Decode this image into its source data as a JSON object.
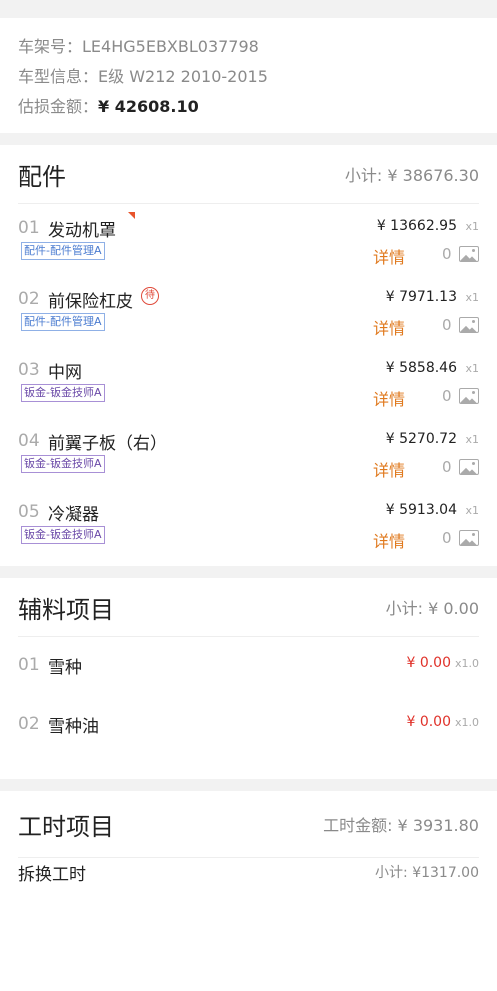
{
  "vehicle": {
    "vin_label": "车架号：",
    "vin": "LE4HG5EBXBL037798",
    "model_label": "车型信息：",
    "model": "E级 W212 2010-2015",
    "loss_label": "估损金额：",
    "loss": "¥ 42608.10"
  },
  "parts": {
    "title": "配件",
    "subtotal": "小计: ¥ 38676.30",
    "detail_label": "详情",
    "items": [
      {
        "no": "01",
        "name": "发动机罩",
        "tag": "配件-配件管理A",
        "price": "¥ 13662.95",
        "qty": "x1",
        "count": "0"
      },
      {
        "no": "02",
        "name": "前保险杠皮",
        "tag": "配件-配件管理A",
        "price": "¥ 7971.13",
        "qty": "x1",
        "count": "0",
        "pending": "待"
      },
      {
        "no": "03",
        "name": "中网",
        "tag": "钣金-钣金技师A",
        "price": "¥ 5858.46",
        "qty": "x1",
        "count": "0"
      },
      {
        "no": "04",
        "name": "前翼子板（右）",
        "tag": "钣金-钣金技师A",
        "price": "¥ 5270.72",
        "qty": "x1",
        "count": "0"
      },
      {
        "no": "05",
        "name": "冷凝器",
        "tag": "钣金-钣金技师A",
        "price": "¥ 5913.04",
        "qty": "x1",
        "count": "0"
      }
    ]
  },
  "aux": {
    "title": "辅料项目",
    "subtotal": "小计: ¥ 0.00",
    "items": [
      {
        "no": "01",
        "name": "雪种",
        "price": "¥ 0.00",
        "qty": "x1.0"
      },
      {
        "no": "02",
        "name": "雪种油",
        "price": "¥ 0.00",
        "qty": "x1.0"
      }
    ]
  },
  "labor": {
    "title": "工时项目",
    "amount": "工时金额: ¥ 3931.80",
    "sub_title": "拆换工时",
    "sub_subtotal": "小计: ¥1317.00"
  },
  "colors": {
    "accent_orange": "#e07a1f",
    "price_red": "#e0322a",
    "tag_blue": "#4a7bd0",
    "tag_purple": "#6b4aa8"
  }
}
